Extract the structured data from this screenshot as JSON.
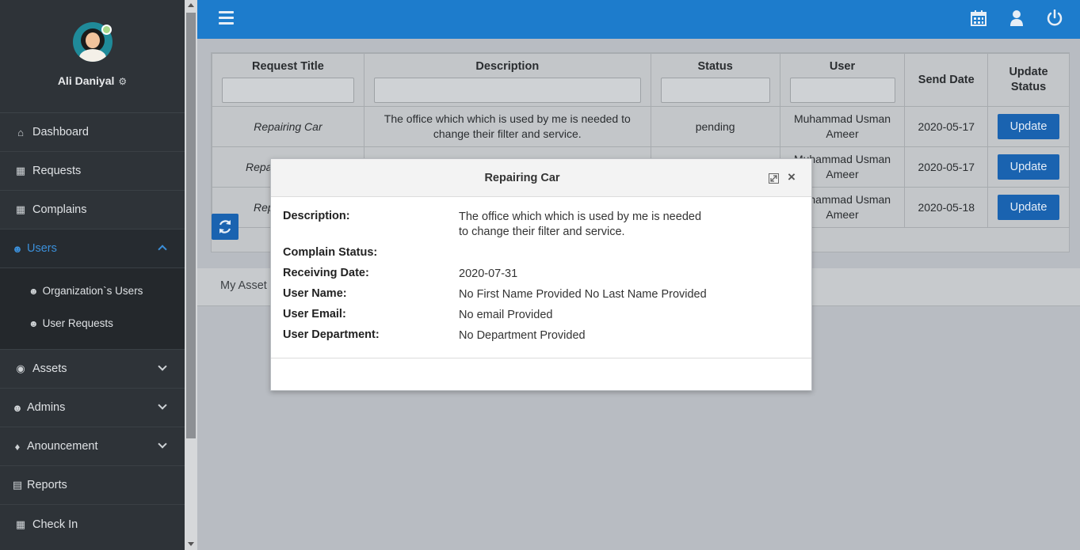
{
  "profile": {
    "name": "Ali Daniyal"
  },
  "nav": {
    "dashboard": "Dashboard",
    "requests": "Requests",
    "complains": "Complains",
    "users": "Users",
    "users_sub": [
      "Organization`s Users",
      "User Requests"
    ],
    "assets": "Assets",
    "admins": "Admins",
    "announcement": "Anouncement",
    "reports": "Reports",
    "checkin": "Check In"
  },
  "table": {
    "headers": [
      "Request Title",
      "Description",
      "Status",
      "User",
      "Send Date",
      "Update Status"
    ],
    "rows": [
      {
        "title": "Repairing Car",
        "description": "The office which which is used by me is needed to change their filter and service.",
        "status": "pending",
        "user": "Muhammad Usman Ameer",
        "date": "2020-05-17",
        "action": "Update"
      },
      {
        "title": "Repa",
        "description": "",
        "status": "",
        "user": "Muhammad Usman Ameer",
        "date": "2020-05-17",
        "action": "Update"
      },
      {
        "title": "Rep",
        "description": "",
        "status": "",
        "user": "Muhammad Usman Ameer",
        "date": "2020-05-18",
        "action": "Update"
      }
    ]
  },
  "tabs": {
    "my_asset": "My Asset"
  },
  "modal": {
    "title": "Repairing Car",
    "fields": [
      {
        "label": "Description:",
        "value": "The office which which is used by me is needed\nto change their filter and service."
      },
      {
        "label": "Complain Status:",
        "value": ""
      },
      {
        "label": "Receiving Date:",
        "value": "2020-07-31"
      },
      {
        "label": "User Name:",
        "value": "No First Name Provided No Last Name Provided"
      },
      {
        "label": "User Email:",
        "value": "No email Provided"
      },
      {
        "label": "User Department:",
        "value": "No Department Provided"
      }
    ]
  },
  "colors": {
    "topbar": "#1d7ccc",
    "sidebar": "#2e3338",
    "accent": "#3b8fd9",
    "button": "#1a63b0"
  },
  "icons": [
    "menu-icon",
    "calendar-icon",
    "user-icon",
    "power-icon",
    "home-icon",
    "grid-icon",
    "users-icon",
    "globe-icon",
    "bell-icon",
    "chart-icon",
    "refresh-icon",
    "expand-icon",
    "close-icon",
    "gear-icon"
  ]
}
